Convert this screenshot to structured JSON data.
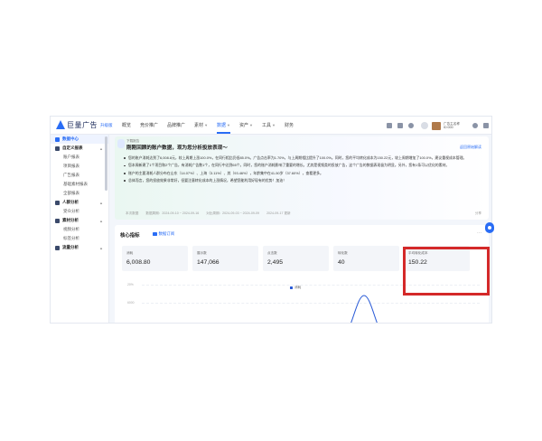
{
  "app": {
    "logo_text": "巨量广告",
    "edition": "升级版"
  },
  "nav": [
    {
      "label": "概览",
      "caret": false
    },
    {
      "label": "竞价推广",
      "caret": false
    },
    {
      "label": "品牌推广",
      "caret": false
    },
    {
      "label": "素材",
      "caret": true
    },
    {
      "label": "数据",
      "caret": true,
      "active": true
    },
    {
      "label": "资产",
      "caret": true
    },
    {
      "label": "工具",
      "caret": true
    },
    {
      "label": "财务",
      "caret": false
    }
  ],
  "account": {
    "name": "广告主名称 ID:000"
  },
  "sidebar": [
    {
      "label": "数据中心",
      "type": "active"
    },
    {
      "label": "自定义报表",
      "type": "group"
    },
    {
      "label": "账户报表",
      "type": "item"
    },
    {
      "label": "项目报表",
      "type": "item"
    },
    {
      "label": "广告报表",
      "type": "item"
    },
    {
      "label": "基础素材报表",
      "type": "item"
    },
    {
      "label": "全部报表",
      "type": "item"
    },
    {
      "label": "人群分析",
      "type": "group"
    },
    {
      "label": "受众分析",
      "type": "item"
    },
    {
      "label": "素材分析",
      "type": "group"
    },
    {
      "label": "视频分析",
      "type": "item"
    },
    {
      "label": "标签分析",
      "type": "item"
    },
    {
      "label": "流量分析",
      "type": "group"
    }
  ],
  "insight": {
    "small_label": "下载报告",
    "title": "刚刚回顾的账户数据，现为您分析投放表现～",
    "link": "返回原始解读",
    "bullets": [
      "您的账户消耗达到了6,008.8元，较上周期上涨100.0%，在同行相比仍低85.0%。广告点击率为1.70%，与上周期相比提升了100.0%。同时，您的平均转化成本为150.22元，较上周期增加了100.0%，建议重视成本管理。",
      "您本周新建了1个项目和2个广告，有消耗广告数1个，在同行中达到65个。同时，您的账户消耗影响了重要的增长。尤其是视频类的投放广告，这个广告的数据表现极为明显。另外，您有1条可以优化的素材。",
      "账户的主要消耗人群分布在山东（14.07%）、上海（3.11%）、其（93.46%），年龄集中在41-50岁（37.60%），查看更多。",
      "总体而言，您的投放效果非常好，但要注意转化成本的上涨情况，希望您能利用好现有的优势！加油！"
    ],
    "footer": [
      "本次数据",
      "数据周期：2024-09-10 ~ 2024-09-16",
      "对比周期：2024-09-03 ~ 2024-09-09",
      "2024-09-17 更新"
    ],
    "share": "分享"
  },
  "panel": {
    "title": "核心指标",
    "subscribe": "数据订阅",
    "more": "···",
    "cards": [
      {
        "label": "消耗",
        "value": "6,008.80"
      },
      {
        "label": "展示数",
        "value": "147,066"
      },
      {
        "label": "点击数",
        "value": "2,495"
      },
      {
        "label": "转化数",
        "value": "40"
      },
      {
        "label": "平均转化成本",
        "value": "150.22"
      }
    ],
    "legend": "消耗",
    "axis_top": "20%",
    "axis_mid": "6000"
  }
}
